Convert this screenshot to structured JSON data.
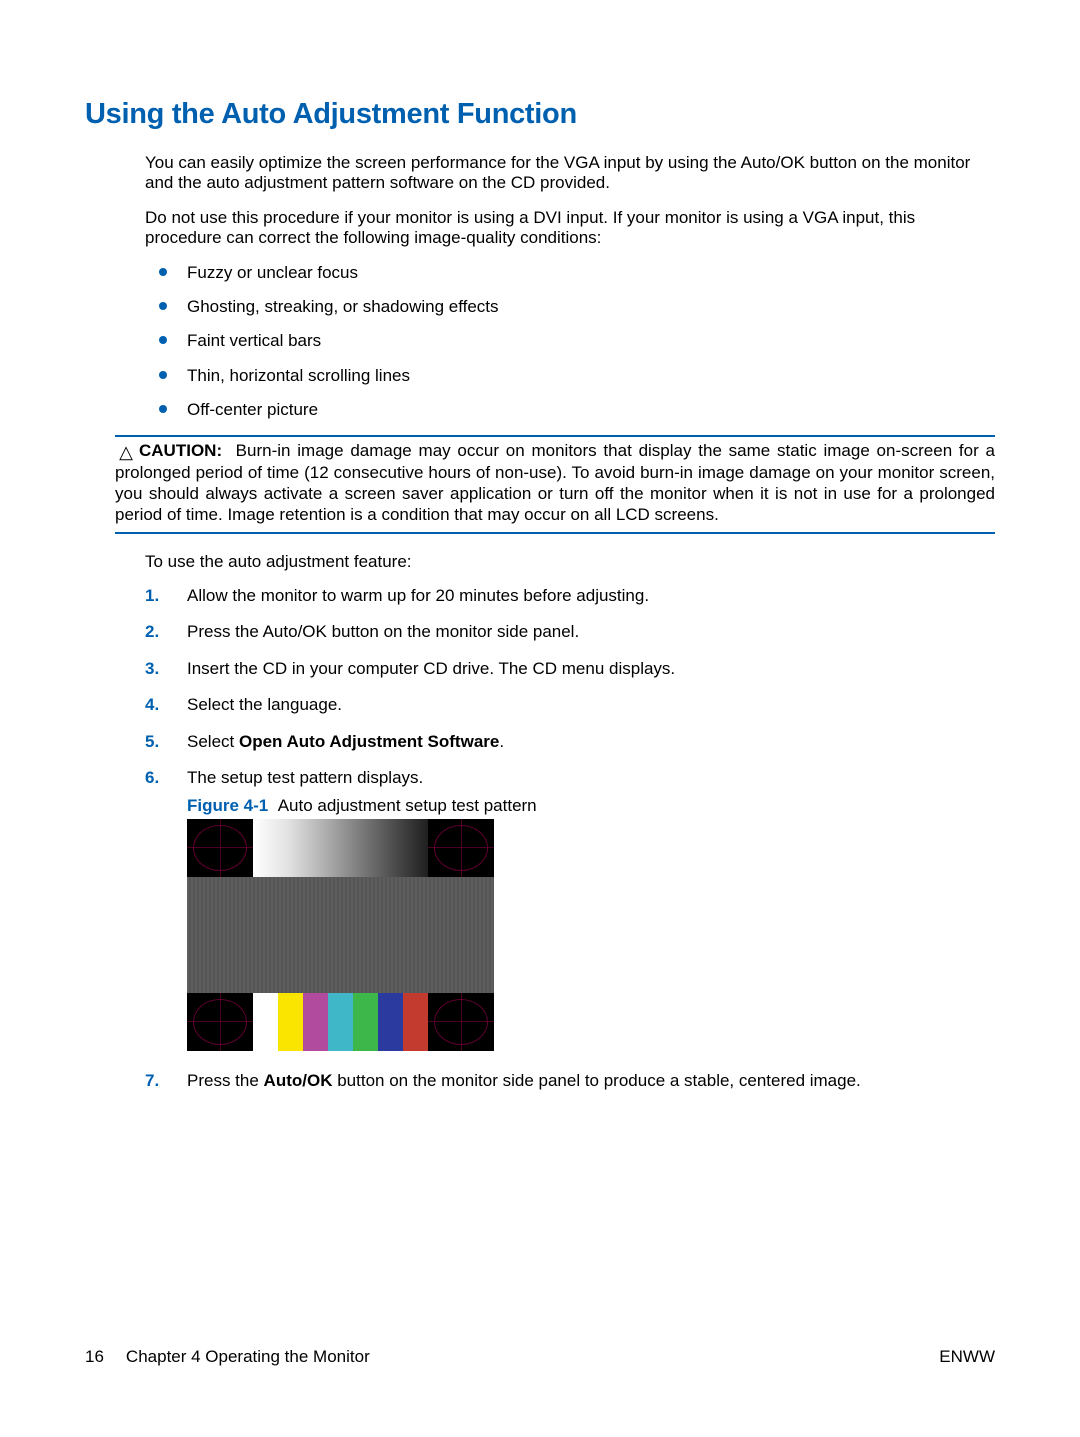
{
  "heading": "Using the Auto Adjustment Function",
  "para1": "You can easily optimize the screen performance for the VGA input by using the Auto/OK button on the monitor and the auto adjustment pattern software on the CD provided.",
  "para2": "Do not use this procedure if your monitor is using a DVI input. If your monitor is using a VGA input, this procedure can correct the following image-quality conditions:",
  "bullets": [
    "Fuzzy or unclear focus",
    "Ghosting, streaking, or shadowing effects",
    "Faint vertical bars",
    "Thin, horizontal scrolling lines",
    "Off-center picture"
  ],
  "caution": {
    "label": "CAUTION:",
    "text": "Burn-in image damage may occur on monitors that display the same static image on-screen for a prolonged period of time (12 consecutive hours of non-use). To avoid burn-in image damage on your monitor screen, you should always activate a screen saver application or turn off the monitor when it is not in use for a prolonged period of time. Image retention is a condition that may occur on all LCD screens."
  },
  "para3": "To use the auto adjustment feature:",
  "steps": [
    {
      "num": "1.",
      "text": "Allow the monitor to warm up for 20 minutes before adjusting."
    },
    {
      "num": "2.",
      "text": "Press the Auto/OK button on the monitor side panel."
    },
    {
      "num": "3.",
      "text": "Insert the CD in your computer CD drive. The CD menu displays."
    },
    {
      "num": "4.",
      "text": "Select the language."
    },
    {
      "num": "5.",
      "prefix": "Select ",
      "bold": "Open Auto Adjustment Software",
      "suffix": "."
    },
    {
      "num": "6.",
      "text": "The setup test pattern displays."
    },
    {
      "num": "7.",
      "prefix": "Press the ",
      "bold": "Auto/OK",
      "suffix": " button on the monitor side panel to produce a stable, centered image."
    }
  ],
  "figure": {
    "label": "Figure 4-1",
    "caption": "Auto adjustment setup test pattern"
  },
  "footer": {
    "page": "16",
    "chapter": "Chapter 4   Operating the Monitor",
    "right": "ENWW"
  }
}
